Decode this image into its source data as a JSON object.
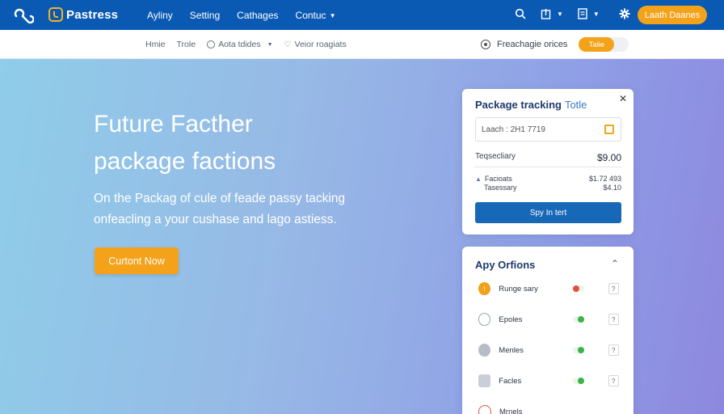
{
  "nav": {
    "brand": "Pastress",
    "links": [
      {
        "label": "Ayliny",
        "caret": false
      },
      {
        "label": "Setting",
        "caret": false
      },
      {
        "label": "Cathages",
        "caret": false
      },
      {
        "label": "Contuc",
        "caret": true
      }
    ],
    "cta": "Laath Daanes"
  },
  "subnav": {
    "crumbs": [
      "Hmie",
      "Trole",
      "Aota tdides",
      "Veior roagiats"
    ],
    "right_label": "Freachagie orices",
    "toggle_label": "Taiie"
  },
  "hero": {
    "title_line1": "Future Facther",
    "title_line2": "package factions",
    "subtitle_line1": "On the Packag of cule of feade passy tacking",
    "subtitle_line2": "onfeacling a your cushase and lago astiess.",
    "cta": "Curtont Now"
  },
  "tracking": {
    "title": "Package tracking",
    "title_suffix": "Totle",
    "input_value": "Laach : 2H1 7719",
    "row1_label": "Teqsecliary",
    "row1_value": "$9.00",
    "row2_label": "Facioats",
    "row2_value": "$1.72 493",
    "row3_label": "Tasessary",
    "row3_value": "$4.10",
    "button": "Spy In tert"
  },
  "options": {
    "title": "Apy Orfions",
    "items": [
      {
        "label": "Runge sary",
        "icon_color": "#f0a21b",
        "pill_color": "#e0513b"
      },
      {
        "label": "Epoles",
        "icon_color": "#ffffff",
        "pill_color": "#3bb34a"
      },
      {
        "label": "Menles",
        "icon_color": "#b6bcc8",
        "pill_color": "#3bb34a"
      },
      {
        "label": "Facles",
        "icon_color": "#c9ced8",
        "pill_color": "#3bb34a"
      },
      {
        "label": "Mrnels",
        "icon_color": "#ffffff",
        "pill_color": "#3bb34a"
      }
    ]
  },
  "colors": {
    "nav_bg": "#0a5ab4",
    "accent": "#f5a21b",
    "button_blue": "#1768b7"
  }
}
